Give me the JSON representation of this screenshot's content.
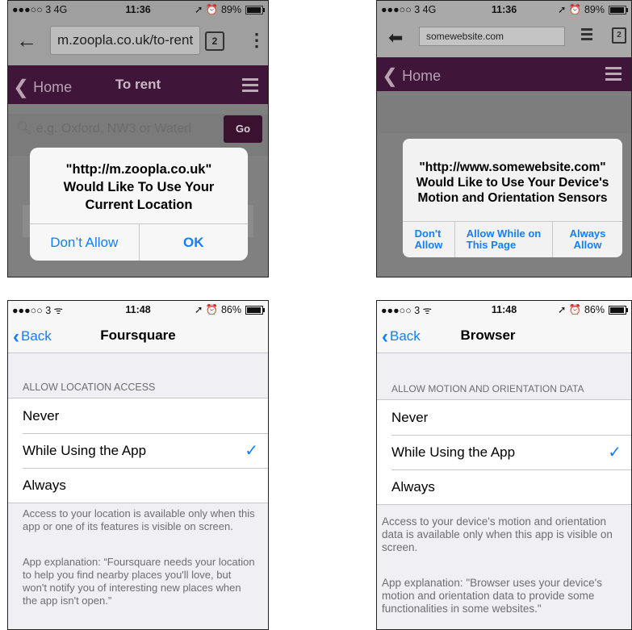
{
  "panel1": {
    "status": {
      "carrier": "●●●○○ 3  4G",
      "time": "11:36",
      "right": "➚ ⏰ 89%"
    },
    "url": "m.zoopla.co.uk/to-rent",
    "tabs_count": "2",
    "nav": {
      "home": "Home",
      "title": "To rent"
    },
    "search_placeholder": "e.g. Oxford, NW3 or Waterl",
    "go_label": "Go",
    "alert": {
      "line1": "\"http://m.zoopla.co.uk\"",
      "line2": "Would Like To Use Your",
      "line3": "Current Location",
      "dont_allow": "Don’t Allow",
      "ok": "OK"
    }
  },
  "panel2": {
    "status": {
      "carrier": "●●●○○ 3  4G",
      "time": "11:36",
      "right": "➚ ⏰ 89%"
    },
    "url": "somewebsite.com",
    "tabs_count": "2",
    "nav": {
      "home": "Home"
    },
    "alert": {
      "line1": "\"http://www.somewebsite.com\"",
      "line2": "Would Like to Use Your Device's",
      "line3": "Motion and Orientation Sensors",
      "dont_allow_1": "Don't",
      "dont_allow_2": "Allow",
      "allow_page_1": "Allow While on",
      "allow_page_2": "This Page",
      "always_1": "Always",
      "always_2": "Allow"
    }
  },
  "panel3": {
    "status": {
      "carrier": "●●●○○ 3 ᯤ",
      "time": "11:48",
      "right": "➚ ⏰ 86%"
    },
    "back": "Back",
    "title": "Foursquare",
    "section": "ALLOW LOCATION ACCESS",
    "options": [
      "Never",
      "While Using the App",
      "Always"
    ],
    "selected": "While Using the App",
    "note1": "Access to your location is available only when this app or one of its features is visible on screen.",
    "note2": "App explanation: “Foursquare needs your location to help you find nearby places you'll love, but won't notify you of interesting new places when the app isn't open.”"
  },
  "panel4": {
    "status": {
      "carrier": "●●●○○ 3 ᯤ",
      "time": "11:48",
      "right": "➚ ⏰ 86%"
    },
    "back": "Back",
    "title": "Browser",
    "section": "ALLOW MOTION AND ORIENTATION DATA",
    "options": [
      "Never",
      "While Using the App",
      "Always"
    ],
    "selected": "While Using the App",
    "note1": "Access to your device's motion and orientation data is available only when this app is visible on screen.",
    "note2": "App explanation: \"Browser uses your device's motion and orientation data to provide some functionalities in some websites.\""
  },
  "colors": {
    "accent": "#147efb",
    "brand_purple": "#40153a"
  }
}
